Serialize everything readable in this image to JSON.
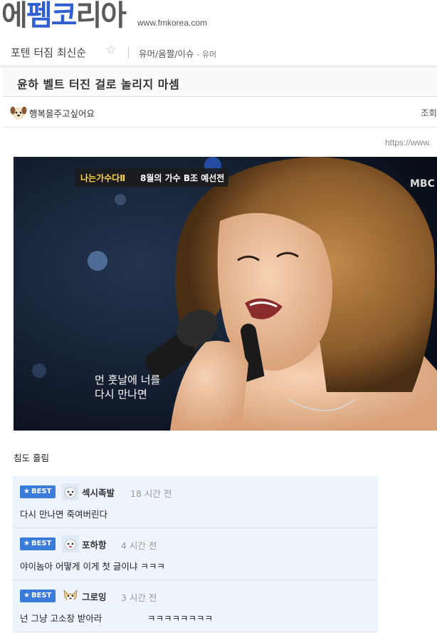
{
  "site": {
    "logo_parts": [
      "에",
      "펨",
      "코",
      "리아"
    ],
    "url": "www.fmkorea.com"
  },
  "category": {
    "title": "포텐 터짐 최신순",
    "star_icon": "star-outline-icon",
    "path": "유머/움짤/이슈",
    "sub": "- 유머"
  },
  "post": {
    "title": "윤하 벨트 터진 걸로 놀리지 마셈",
    "author": "행복을주고싶어요",
    "view_label": "조회",
    "source_url": "https://www.",
    "image": {
      "logo_text": "나는가수다Ⅱ",
      "caption": "8월의 가수 B조 예선전",
      "channel": "MBC",
      "subtitle_line1": "먼 훗날에 너를",
      "subtitle_line2": "다시 만나면"
    },
    "body": "침도 흘림"
  },
  "comments": [
    {
      "badge": "BEST",
      "name": "섹시족발",
      "time": "18 시간 전",
      "text": "다시 만나면 죽여버린다",
      "avatar": "dog-avatar-icon"
    },
    {
      "badge": "BEST",
      "name": "포하항",
      "time": "4 시간 전",
      "text": "야이놈아 어떻게 이게 첫 글이냐 ㅋㅋㅋ",
      "avatar": "dog-avatar-icon"
    },
    {
      "badge": "BEST",
      "name": "그로잉",
      "time": "3 시간 전",
      "text": "넌 그냥 고소장 받아라                ㅋㅋㅋㅋㅋㅋㅋㅋ",
      "avatar": "puppy-avatar-icon"
    }
  ],
  "colors": {
    "accent": "#2f5fd0",
    "best_badge": "#3b7bd9",
    "comment_bg": "#eef4fc"
  }
}
